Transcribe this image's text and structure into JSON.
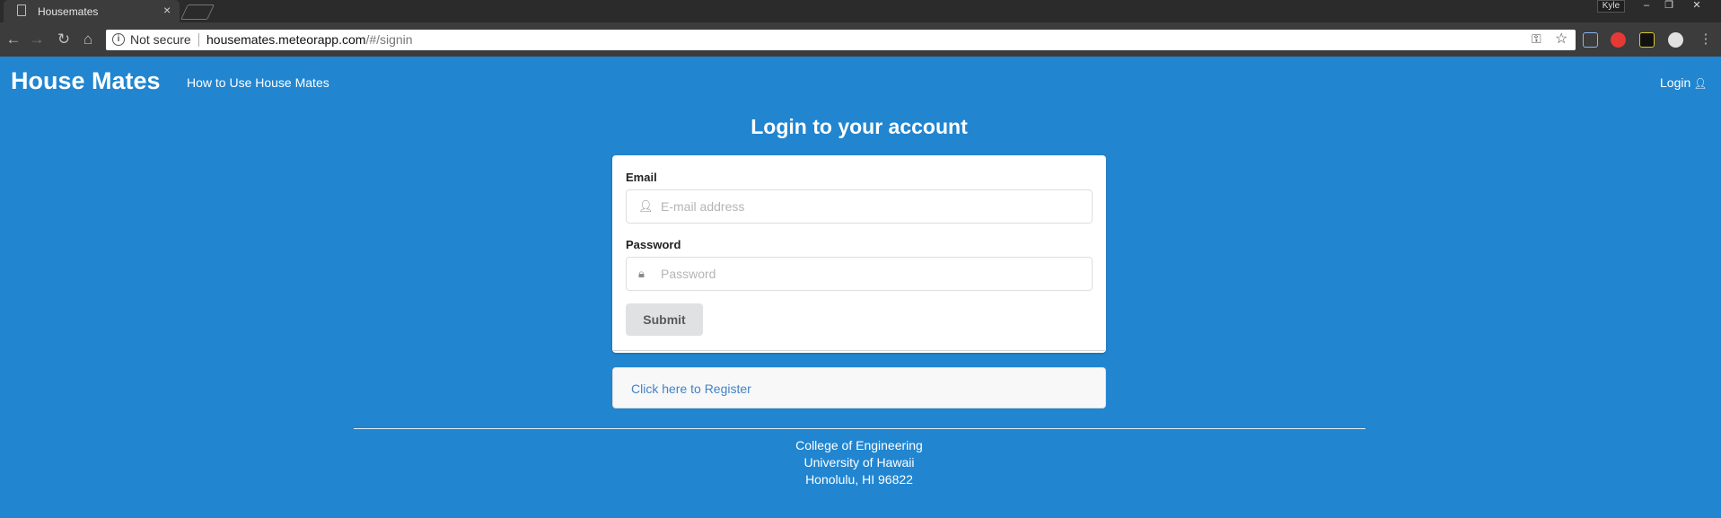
{
  "browser": {
    "tab_title": "Housemates",
    "tab_close": "×",
    "profile_name": "Kyle",
    "window_controls": [
      "–",
      "❐",
      "✕"
    ],
    "nav_icons": [
      "back-icon",
      "forward-icon",
      "reload-icon",
      "home-icon"
    ],
    "security_label": "Not secure",
    "url_host": "housemates.meteorapp.com",
    "url_path": "/#/signin",
    "extension_colors": [
      "#8ab4f8",
      "#e53935",
      "#111111",
      "#e0e0e0"
    ]
  },
  "navbar": {
    "brand": "House Mates",
    "how_to_link": "How to Use House Mates",
    "login_link": "Login"
  },
  "login": {
    "heading": "Login to your account",
    "email_label": "Email",
    "email_placeholder": "E-mail address",
    "email_value": "",
    "password_label": "Password",
    "password_placeholder": "Password",
    "password_value": "",
    "submit_label": "Submit",
    "register_link": "Click here to Register"
  },
  "footer": {
    "line1": "College of Engineering",
    "line2": "University of Hawaii",
    "line3": "Honolulu, HI 96822"
  },
  "colors": {
    "page_background": "#2185d0",
    "register_link": "#4183c4"
  }
}
